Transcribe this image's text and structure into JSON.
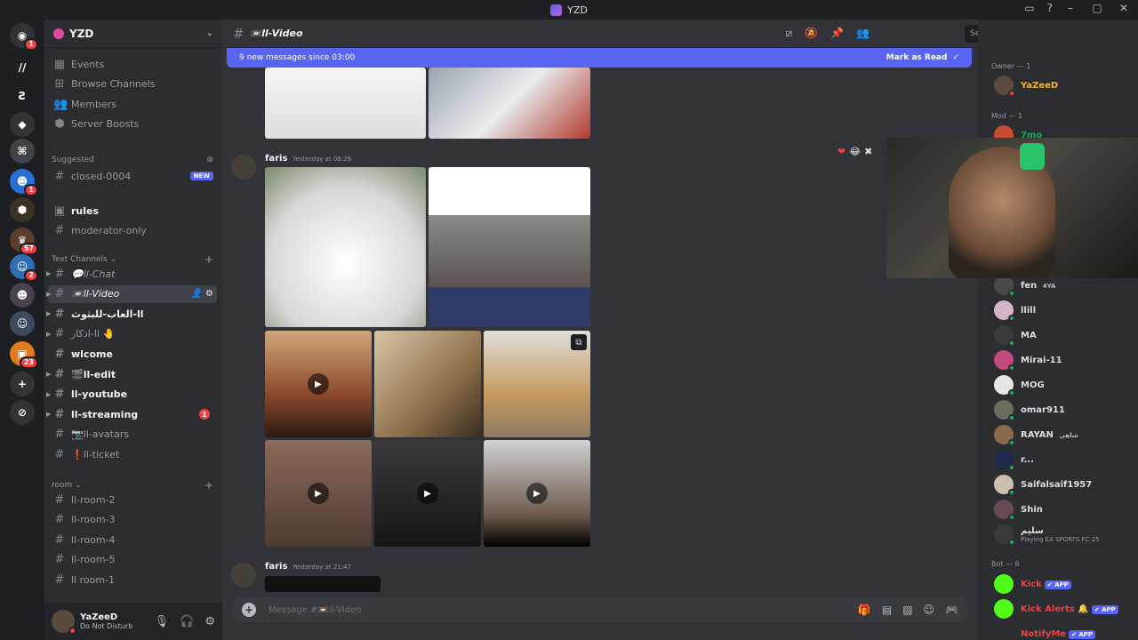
{
  "window": {
    "title": "YZD"
  },
  "rail": {
    "servers": [
      {
        "id": "home",
        "color": "#313338",
        "glyph": "◉",
        "badge": "1"
      },
      {
        "id": "s1",
        "color": "#1e1f22",
        "glyph": "//",
        "badge": ""
      },
      {
        "id": "s2",
        "color": "#1e1f22",
        "glyph": "Ƨ",
        "badge": ""
      },
      {
        "id": "s3",
        "color": "#313338",
        "glyph": "◆",
        "badge": ""
      },
      {
        "id": "s4",
        "color": "#41434a",
        "glyph": "⌘",
        "badge": ""
      },
      {
        "id": "s5",
        "color": "#2a6fd6",
        "glyph": "☻",
        "badge": "1"
      },
      {
        "id": "s6",
        "color": "#3a3325",
        "glyph": "⬢",
        "badge": ""
      },
      {
        "id": "s7",
        "color": "#5a3d2b",
        "glyph": "♛",
        "badge": "57"
      },
      {
        "id": "s8",
        "color": "#2f6fb0",
        "glyph": "☺",
        "badge": "2"
      },
      {
        "id": "s9",
        "color": "#4b3f52",
        "glyph": "☻",
        "badge": ""
      },
      {
        "id": "s10",
        "color": "#3c4a5e",
        "glyph": "☺",
        "badge": ""
      },
      {
        "id": "s11",
        "color": "#e07b1f",
        "glyph": "▣",
        "badge": "23"
      },
      {
        "id": "add",
        "color": "#313338",
        "glyph": "+",
        "badge": ""
      },
      {
        "id": "explore",
        "color": "#313338",
        "glyph": "⊘",
        "badge": ""
      }
    ]
  },
  "server": {
    "name": "YZD"
  },
  "sidebar": {
    "nav": [
      "Events",
      "Browse Channels",
      "Members",
      "Server Boosts"
    ],
    "suggested_label": "Suggested",
    "suggested_channel": "closed-0004",
    "new_tag": "NEW",
    "top_channels": [
      "rules",
      "moderator-only"
    ],
    "text_category": "Text Channels",
    "text_channels": [
      {
        "name": "💬ll-Chat",
        "style": "italic"
      },
      {
        "name": "📼ll-Video",
        "style": "italic-active"
      },
      {
        "name": "العاب-للبثوث-ll",
        "style": "bright"
      },
      {
        "name": "اذكار-ll 🤚",
        "style": "muted"
      },
      {
        "name": "wlcome",
        "style": "bright"
      },
      {
        "name": "🎬ll-edit",
        "style": "bright"
      },
      {
        "name": "ll-youtube",
        "style": "bright"
      },
      {
        "name": "ll-streaming",
        "style": "bright",
        "badge": "1"
      },
      {
        "name": "📷ll-avatars",
        "style": "muted"
      },
      {
        "name": "❗ll-ticket",
        "style": "muted"
      }
    ],
    "room_category": "room",
    "rooms": [
      "ll-room-2",
      "ll-room-3",
      "ll-room-4",
      "ll-room-5",
      "ll room-1"
    ]
  },
  "user": {
    "name": "YaZeeD",
    "status": "Do Not Disturb"
  },
  "channel": {
    "name": "📼ll-Video"
  },
  "banner": {
    "text": "9 new messages since 03:00",
    "action": "Mark as Read"
  },
  "messages": [
    {
      "author": "faris",
      "time": "Yesterday at 08:26"
    },
    {
      "author": "faris",
      "time": "Yesterday at 21:47"
    }
  ],
  "reactions": [
    "❤",
    "😂",
    "✖"
  ],
  "composer": {
    "placeholder": "Message #📼ll-Video"
  },
  "search": {
    "placeholder": "Search"
  },
  "members": {
    "owner_header": "Owner — 1",
    "owner": {
      "name": "YaZeeD",
      "color": "#f0b232"
    },
    "mod_header": "Mod — 1",
    "mod": {
      "name": "7mo",
      "color": "#3ba55d"
    },
    "list": [
      {
        "name": "fen",
        "tag": "4YA",
        "sub": ""
      },
      {
        "name": "llill",
        "tag": "",
        "sub": ""
      },
      {
        "name": "MA",
        "tag": "",
        "sub": ""
      },
      {
        "name": "Mirai-11",
        "tag": "",
        "sub": ""
      },
      {
        "name": "MOG",
        "tag": "",
        "sub": ""
      },
      {
        "name": "omar911",
        "tag": "",
        "sub": ""
      },
      {
        "name": "RAYAN",
        "tag": "شاهي",
        "sub": ""
      },
      {
        "name": "r...",
        "tag": "",
        "sub": ""
      },
      {
        "name": "Saifalsaif1957",
        "tag": "",
        "sub": ""
      },
      {
        "name": "Shin",
        "tag": "",
        "sub": ""
      },
      {
        "name": "سليم",
        "tag": "",
        "sub": "Playing EA SPORTS FC 25"
      }
    ],
    "bot_header": "Bot — 6",
    "bots": [
      {
        "name": "Kick",
        "tag": "✔ APP",
        "color": "#f23f42"
      },
      {
        "name": "Kick Alerts 🔔",
        "tag": "✔ APP",
        "color": "#f23f42"
      },
      {
        "name": "NotifyMe",
        "tag": "✔ APP",
        "color": "#f23f42"
      }
    ]
  },
  "colors": {
    "accent": "#5865f2",
    "danger": "#f23f42",
    "online": "#23a55a",
    "dnd": "#f23f42"
  }
}
